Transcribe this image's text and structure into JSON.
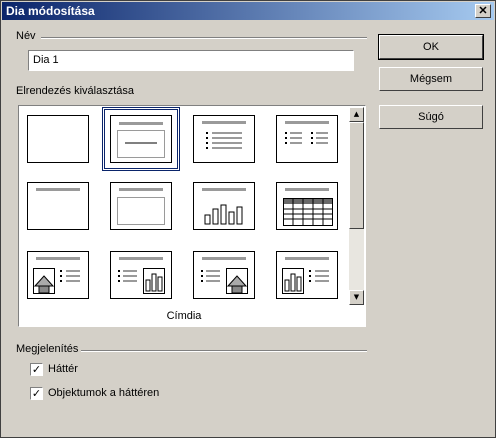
{
  "window": {
    "title": "Dia módosítása",
    "close_glyph": "✕"
  },
  "name_section": {
    "label": "Név",
    "value": "Dia 1"
  },
  "layout_section": {
    "label": "Elrendezés kiválasztása",
    "caption": "Címdia",
    "layouts": [
      "empty",
      "title-center",
      "title-content",
      "title-2content",
      "title-only",
      "centered-text",
      "title-chart",
      "title-table",
      "title-clipart-text",
      "title-text-chart",
      "title-text-clipart",
      "title-chart-text"
    ],
    "selected_index": 1
  },
  "buttons": {
    "ok": "OK",
    "cancel": "Mégsem",
    "help": "Súgó"
  },
  "display_section": {
    "label": "Megjelenítés",
    "checkboxes": [
      {
        "label": "Háttér",
        "checked": true
      },
      {
        "label": "Objektumok a háttéren",
        "checked": true
      }
    ]
  }
}
